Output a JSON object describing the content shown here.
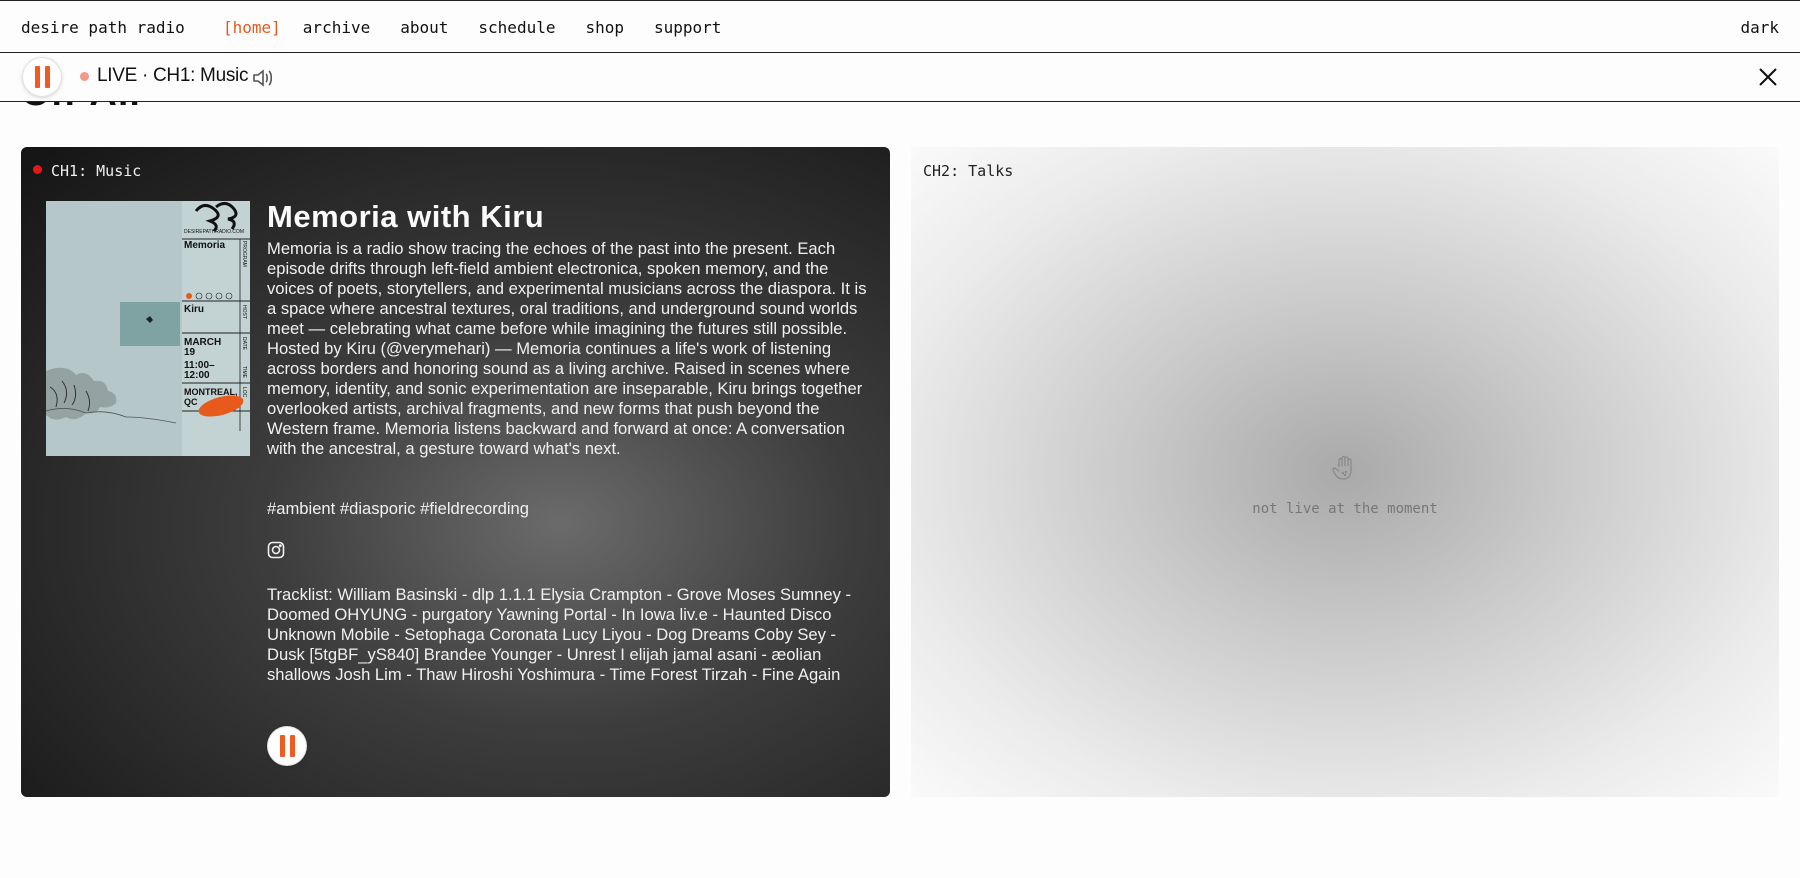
{
  "nav": {
    "brand": "desire path radio",
    "links": [
      "[home]",
      "archive",
      "about",
      "schedule",
      "shop",
      "support"
    ],
    "theme_toggle": "dark"
  },
  "player": {
    "status": "LIVE · CH1: Music",
    "icons": [
      "pause-icon",
      "speaker-icon",
      "close-icon"
    ]
  },
  "page": {
    "heading": "On-Air"
  },
  "ch1": {
    "label": "CH1: Music",
    "title": "Memoria with Kiru",
    "description": "Memoria is a radio show tracing the echoes of the past into the present. Each episode drifts through left-field ambient electronica, spoken memory, and the voices of poets, storytellers, and experimental musicians across the diaspora. It is a space where ancestral textures, oral traditions, and underground sound worlds meet — celebrating what came before while imagining the futures still possible. Hosted by Kiru (@verymehari) — Memoria continues a life's work of listening across borders and honoring sound as a living archive. Raised in scenes where memory, identity, and sonic experimentation are inseparable, Kiru brings together overlooked artists, archival fragments, and new forms that push beyond the Western frame. Memoria listens backward and forward at once: A conversation with the ancestral, a gesture toward what's next.",
    "tags": "#ambient #diasporic #fieldrecording",
    "tracklist": "Tracklist: William Basinski - dlp 1.1.1 Elysia Crampton - Grove Moses Sumney - Doomed OHYUNG - purgatory Yawning Portal - In Iowa liv.e - Haunted Disco Unknown Mobile - Setophaga Coronata Lucy Liyou - Dog Dreams Coby Sey - Dusk [5tgBF_yS840] Brandee Younger - Unrest I elijah jamal asani - æolian shallows Josh Lim - Thaw Hiroshi Yoshimura - Time Forest Tirzah - Fine Again",
    "artwork": {
      "site": "DESIREPATHRADIO.COM",
      "program": "Memoria",
      "host": "Kiru",
      "date_month": "MARCH",
      "date_day": "19",
      "time_start": "11:00–",
      "time_end": "12:00",
      "location_1": "MONTREAL,",
      "location_2": "QC",
      "side_labels": [
        "PROGRAM",
        "HOST",
        "DATE",
        "TIME",
        "LOC"
      ]
    }
  },
  "ch2": {
    "label": "CH2: Talks",
    "status": "not live at the moment"
  },
  "colors": {
    "accent": "#f15a22",
    "nav_active": "#e55a1c",
    "live_dot": "#e41818"
  }
}
